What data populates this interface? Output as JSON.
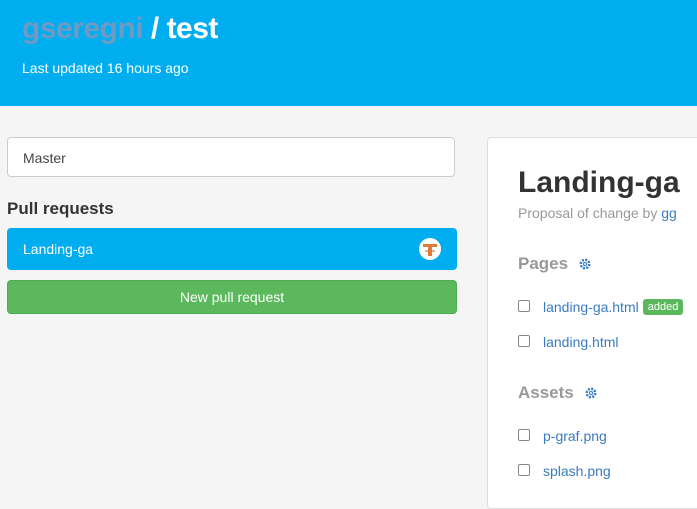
{
  "header": {
    "owner": "gseregni",
    "separator": " / ",
    "repo": "test",
    "last_updated": "Last updated 16 hours ago"
  },
  "sidebar": {
    "branch": "Master",
    "pull_requests_heading": "Pull requests",
    "pull_requests": [
      {
        "label": "Landing-ga",
        "avatar": "user-avatar"
      }
    ],
    "new_pr_label": "New pull request"
  },
  "detail": {
    "title": "Landing-ga",
    "proposal_prefix": "Proposal of change by ",
    "proposal_author": "gg",
    "pages_heading": "Pages",
    "pages": [
      {
        "name": "landing-ga.html",
        "badge": "added"
      },
      {
        "name": "landing.html"
      }
    ],
    "assets_heading": "Assets",
    "assets": [
      {
        "name": "p-graf.png"
      },
      {
        "name": "splash.png"
      }
    ]
  },
  "colors": {
    "header_bg": "#00aeef",
    "owner_text": "#6e9ac4",
    "pr_item_bg": "#00aeef",
    "new_pr_bg": "#5cb85c",
    "link": "#3a7bbf",
    "badge_added": "#5cb85c"
  },
  "icons": {
    "settings": "gear-icon",
    "avatar": "user-avatar"
  }
}
